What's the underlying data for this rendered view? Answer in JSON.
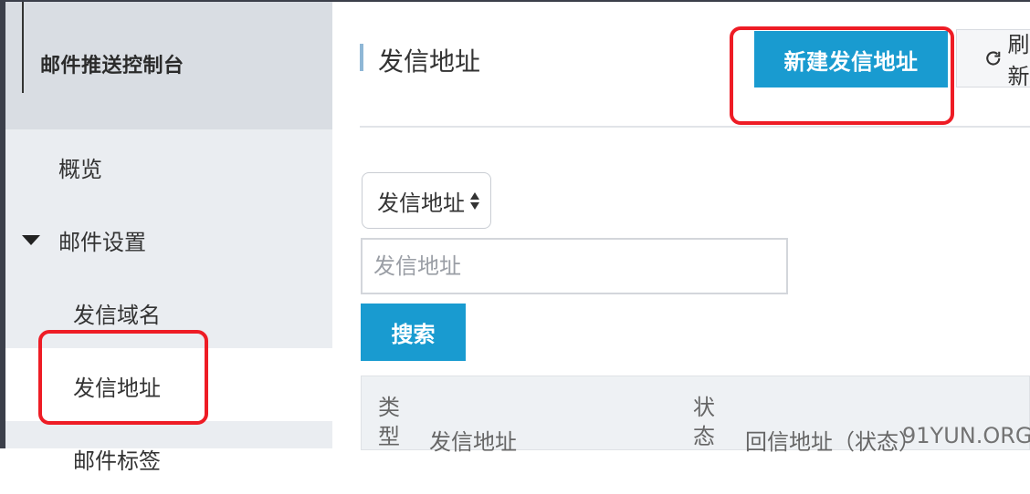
{
  "sidebar": {
    "title": "邮件推送控制台",
    "items": [
      {
        "label": "概览"
      },
      {
        "label": "邮件设置"
      },
      {
        "label": "发信域名"
      },
      {
        "label": "发信地址"
      },
      {
        "label": "邮件标签"
      }
    ]
  },
  "main": {
    "page_title": "发信地址",
    "new_button_label": "新建发信地址",
    "refresh_label": "刷新",
    "filter": {
      "select_value": "发信地址",
      "input_placeholder": "发信地址",
      "search_label": "搜索"
    },
    "table": {
      "columns": [
        "类型",
        "发信地址",
        "状态",
        "回信地址（状态）"
      ]
    }
  },
  "watermark": "91YUN.ORG",
  "colors": {
    "accent": "#199bd0",
    "highlight": "#ee1c25",
    "sidebar_bg": "#eaedf1",
    "sidebar_header_bg": "#d9dde3"
  },
  "icons": [
    "refresh-icon",
    "caret-down-icon",
    "updown-icon"
  ]
}
